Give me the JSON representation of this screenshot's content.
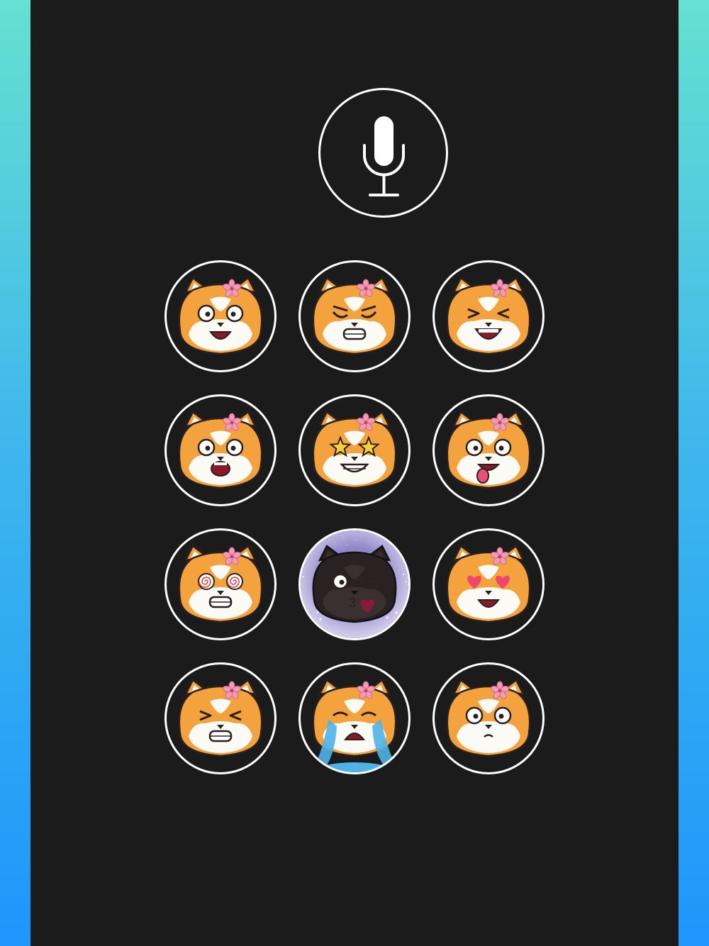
{
  "colors": {
    "panel": "#1b1b1b",
    "outline": "#ffffff",
    "fur": "#f3a23d",
    "fur_light": "#fbfaf5",
    "flower": "#f39ab6",
    "gradient_top": "#66e0d0",
    "gradient_bottom": "#1e96fb"
  },
  "mic_button": {
    "icon": "microphone-icon"
  },
  "stickers": [
    {
      "name": "sticker-happy",
      "icon": "shiba-happy-icon",
      "eyes": "open",
      "mouth": "smile"
    },
    {
      "name": "sticker-angry",
      "icon": "shiba-angry-icon",
      "eyes": "angry",
      "mouth": "teeth"
    },
    {
      "name": "sticker-laughing",
      "icon": "shiba-laughing-icon",
      "eyes": "squint",
      "mouth": "laugh"
    },
    {
      "name": "sticker-shocked",
      "icon": "shiba-shocked-icon",
      "eyes": "open",
      "mouth": "shock"
    },
    {
      "name": "sticker-star-eyes",
      "icon": "shiba-star-eyes-icon",
      "eyes": "stars",
      "mouth": "grin"
    },
    {
      "name": "sticker-tongue",
      "icon": "shiba-tongue-icon",
      "eyes": "open",
      "mouth": "tongue"
    },
    {
      "name": "sticker-dizzy",
      "icon": "shiba-dizzy-icon",
      "eyes": "spiral",
      "mouth": "teeth"
    },
    {
      "name": "sticker-kiss-selected",
      "icon": "shiba-kiss-icon",
      "eyes": "wink",
      "mouth": "kiss",
      "selected": true
    },
    {
      "name": "sticker-heart-eyes",
      "icon": "shiba-heart-eyes-icon",
      "eyes": "hearts",
      "mouth": "smile"
    },
    {
      "name": "sticker-grimace",
      "icon": "shiba-grimace-icon",
      "eyes": "squint",
      "mouth": "teeth"
    },
    {
      "name": "sticker-crying",
      "icon": "shiba-crying-icon",
      "eyes": "cry",
      "mouth": "cry"
    },
    {
      "name": "sticker-confused",
      "icon": "shiba-confused-icon",
      "eyes": "open",
      "mouth": "small"
    }
  ]
}
